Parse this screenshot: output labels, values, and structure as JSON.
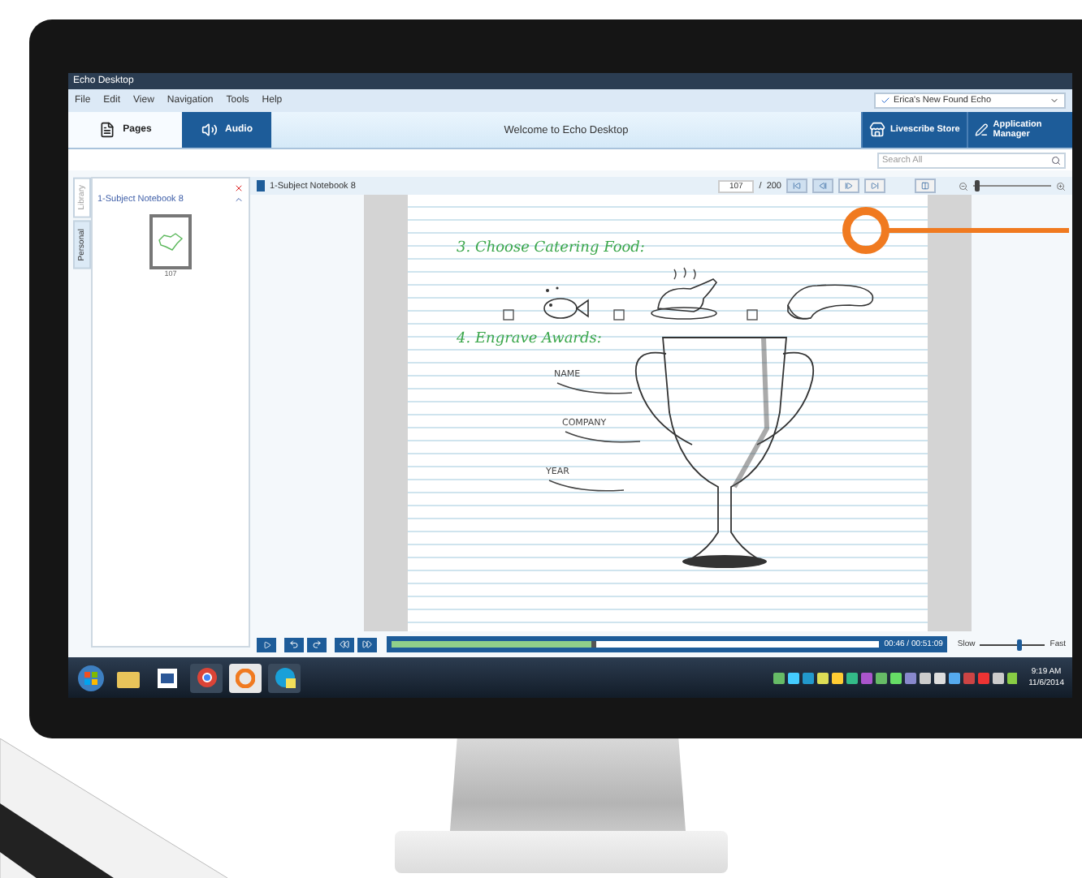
{
  "window": {
    "title": "Echo Desktop"
  },
  "menu": [
    "File",
    "Edit",
    "View",
    "Navigation",
    "Tools",
    "Help"
  ],
  "pen_selector": {
    "value": "Erica's New Found Echo"
  },
  "view_tabs": [
    {
      "label": "Pages",
      "selected": true
    },
    {
      "label": "Audio",
      "selected": false
    }
  ],
  "welcome": "Welcome to Echo Desktop",
  "store_buttons": [
    {
      "label": "Livescribe Store"
    },
    {
      "label": "Application Manager"
    }
  ],
  "search": {
    "placeholder": "Search All"
  },
  "side_tabs": [
    {
      "label": "Library",
      "selected": false
    },
    {
      "label": "Personal",
      "selected": true
    }
  ],
  "notebook_panel": {
    "title": "1-Subject Notebook 8",
    "pages": [
      {
        "label": "107",
        "selected": true
      }
    ]
  },
  "viewer": {
    "title": "1-Subject Notebook 8",
    "page": "107",
    "separator": "/",
    "total": "200"
  },
  "zoom": {
    "level": 0.05
  },
  "note": {
    "heading_1": "3. Choose Catering Food:",
    "heading_2": "4. Engrave Awards:",
    "labels": [
      "NAME",
      "COMPANY",
      "YEAR"
    ]
  },
  "player": {
    "position": {
      "level": 0.41
    },
    "time": "00:46 / 00:51:09",
    "slow": "Slow",
    "fast": "Fast",
    "speed": {
      "level": 0.6
    }
  },
  "taskbar": {
    "time": "9:19 AM",
    "date": "11/6/2014"
  }
}
